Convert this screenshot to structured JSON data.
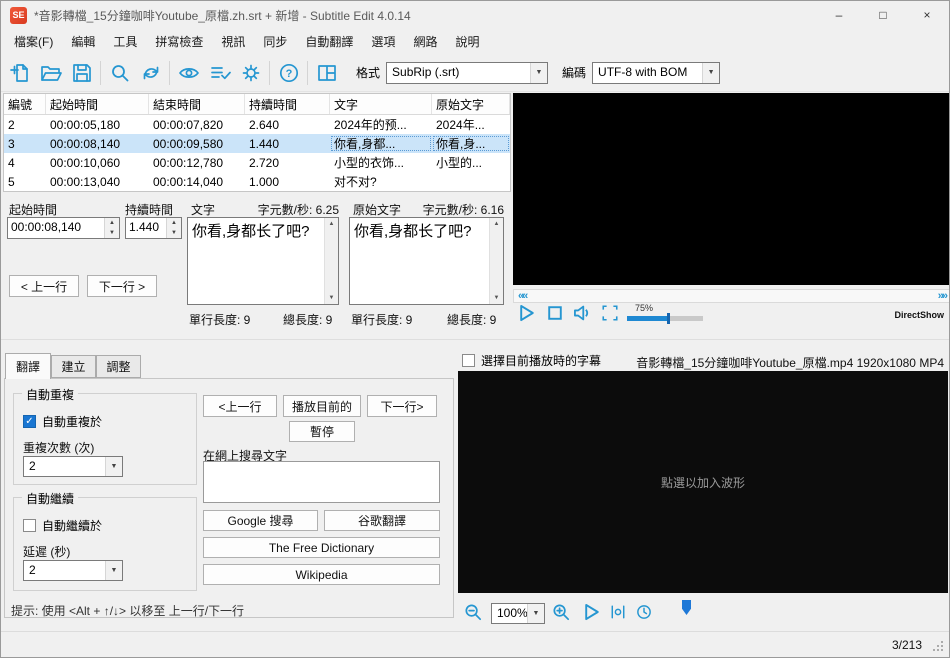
{
  "window": {
    "title": "*音影轉檔_15分鐘咖啡Youtube_原檔.zh.srt + 新增 - Subtitle Edit 4.0.14",
    "icon_text": "SE"
  },
  "icons": {
    "minimize": "–",
    "maximize": "□",
    "close": "×",
    "dropdown_arrow": "▼",
    "spin_up": "▲",
    "spin_down": "▼",
    "check": "✓",
    "seek_left": "««",
    "seek_right": "»»"
  },
  "menu": {
    "items": [
      "檔案(F)",
      "編輯",
      "工具",
      "拼寫檢查",
      "視訊",
      "同步",
      "自動翻譯",
      "選項",
      "網路",
      "說明"
    ]
  },
  "toolbar": {
    "format_label": "格式",
    "format_value": "SubRip (.srt)",
    "encoding_label": "編碼",
    "encoding_value": "UTF-8 with BOM"
  },
  "list": {
    "columns": [
      "編號",
      "起始時間",
      "結束時間",
      "持續時間",
      "文字",
      "原始文字"
    ],
    "rows": [
      {
        "num": "2",
        "start": "00:00:05,180",
        "end": "00:00:07,820",
        "duration": "2.640",
        "text": "2024年的预...",
        "original": "2024年..."
      },
      {
        "num": "3",
        "start": "00:00:08,140",
        "end": "00:00:09,580",
        "duration": "1.440",
        "text": "你看,身都...",
        "original": "你看,身..."
      },
      {
        "num": "4",
        "start": "00:00:10,060",
        "end": "00:00:12,780",
        "duration": "2.720",
        "text": "小型的衣饰...",
        "original": "小型的..."
      },
      {
        "num": "5",
        "start": "00:00:13,040",
        "end": "00:00:14,040",
        "duration": "1.000",
        "text": "对不对?",
        "original": ""
      }
    ]
  },
  "editor": {
    "start_label": "起始時間",
    "start_value": "00:00:08,140",
    "duration_label": "持續時間",
    "duration_value": "1.440",
    "text_label": "文字",
    "text_cps": "字元數/秒: 6.25",
    "text_value": "你看,身都长了吧?",
    "original_label": "原始文字",
    "original_cps": "字元數/秒: 6.16",
    "original_value": "你看,身都长了吧?",
    "prev_button": "< 上一行",
    "next_button": "下一行 >",
    "text_line_length": "單行長度: 9",
    "text_total_length": "總長度: 9",
    "original_line_length": "單行長度: 9",
    "original_total_length": "總長度: 9"
  },
  "video": {
    "volume": "75%",
    "renderer": "DirectShow"
  },
  "tabs": {
    "items": [
      "翻譯",
      "建立",
      "調整"
    ]
  },
  "panel": {
    "auto_repeat": {
      "group_label": "自動重複",
      "checkbox_label": "自動重複於",
      "checked": true,
      "count_label": "重複次數 (次)",
      "count_value": "2"
    },
    "auto_continue": {
      "group_label": "自動繼續",
      "checkbox_label": "自動繼續於",
      "checked": false,
      "delay_label": "延遲 (秒)",
      "delay_value": "2"
    },
    "prev_button": "<上一行",
    "play_current_button": "播放目前的",
    "next_button": "下一行>",
    "pause_button": "暫停",
    "search_label": "在網上搜尋文字",
    "search_value": "",
    "google_search_button": "Google 搜尋",
    "google_translate_button": "谷歌翻譯",
    "dictionary_button": "The Free Dictionary",
    "wikipedia_button": "Wikipedia",
    "hint": "提示: 使用 <Alt + ↑/↓> 以移至 上一行/下一行"
  },
  "waveform": {
    "select_subtitle_label": "選擇目前播放時的字幕",
    "file_info": "音影轉檔_15分鐘咖啡Youtube_原檔.mp4 1920x1080 MP4",
    "placeholder": "點選以加入波形",
    "zoom_value": "100%"
  },
  "status": {
    "position": "3/213"
  }
}
